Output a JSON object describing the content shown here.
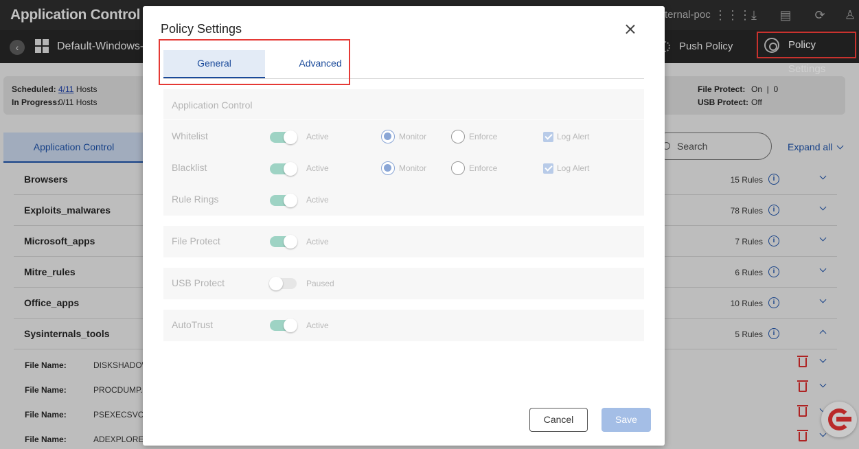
{
  "app": {
    "title": "Application Control",
    "org": "ternal-poc",
    "icons": [
      "apps-grid-icon",
      "download-icon",
      "document-icon",
      "refresh-icon",
      "user-icon"
    ],
    "policy_name": "Default-Windows-",
    "push_policy": "Push Policy",
    "policy_settings": "Policy Settings"
  },
  "summary": {
    "scheduled_label": "Scheduled:",
    "scheduled_value": "4/11",
    "scheduled_suffix": "Hosts",
    "progress_label": "In Progress:",
    "progress_value": "0/11 Hosts",
    "file_protect_label": "File Protect:",
    "file_protect_value": "On  |  0",
    "usb_protect_label": "USB Protect:",
    "usb_protect_value": "Off"
  },
  "background": {
    "tab_label": "Application Control",
    "search_placeholder": "Search",
    "expand_all": "Expand all",
    "rule_groups": [
      {
        "name": "Browsers",
        "count": "15 Rules"
      },
      {
        "name": "Exploits_malwares",
        "count": "78 Rules"
      },
      {
        "name": "Microsoft_apps",
        "count": "7 Rules"
      },
      {
        "name": "Mitre_rules",
        "count": "6 Rules"
      },
      {
        "name": "Office_apps",
        "count": "10 Rules"
      },
      {
        "name": "Sysinternals_tools",
        "count": "5 Rules"
      }
    ],
    "files": [
      {
        "label": "File Name:",
        "value": "DISKSHADOW"
      },
      {
        "label": "File Name:",
        "value": "PROCDUMP.E"
      },
      {
        "label": "File Name:",
        "value": "PSEXECSVC.E"
      },
      {
        "label": "File Name:",
        "value": "ADEXPLORER"
      }
    ]
  },
  "modal": {
    "title": "Policy Settings",
    "tabs": [
      {
        "label": "General",
        "selected": true
      },
      {
        "label": "Advanced",
        "selected": false
      }
    ],
    "application_control": {
      "heading": "Application Control",
      "rows": [
        {
          "label": "Whitelist",
          "status": "Active",
          "monitor": "Monitor",
          "enforce": "Enforce",
          "log_alert": "Log Alert"
        },
        {
          "label": "Blacklist",
          "status": "Active",
          "monitor": "Monitor",
          "enforce": "Enforce",
          "log_alert": "Log Alert"
        },
        {
          "label": "Rule Rings",
          "status": "Active"
        }
      ]
    },
    "file_protect": {
      "label": "File Protect",
      "status": "Active"
    },
    "usb_protect": {
      "label": "USB Protect",
      "status": "Paused"
    },
    "autotrust": {
      "label": "AutoTrust",
      "status": "Active"
    },
    "cancel": "Cancel",
    "save": "Save"
  },
  "colors": {
    "accent": "#1a4a9a",
    "highlight": "#e53935",
    "toggle_on": "#9ed3c4",
    "save_disabled": "#a4bee6"
  }
}
